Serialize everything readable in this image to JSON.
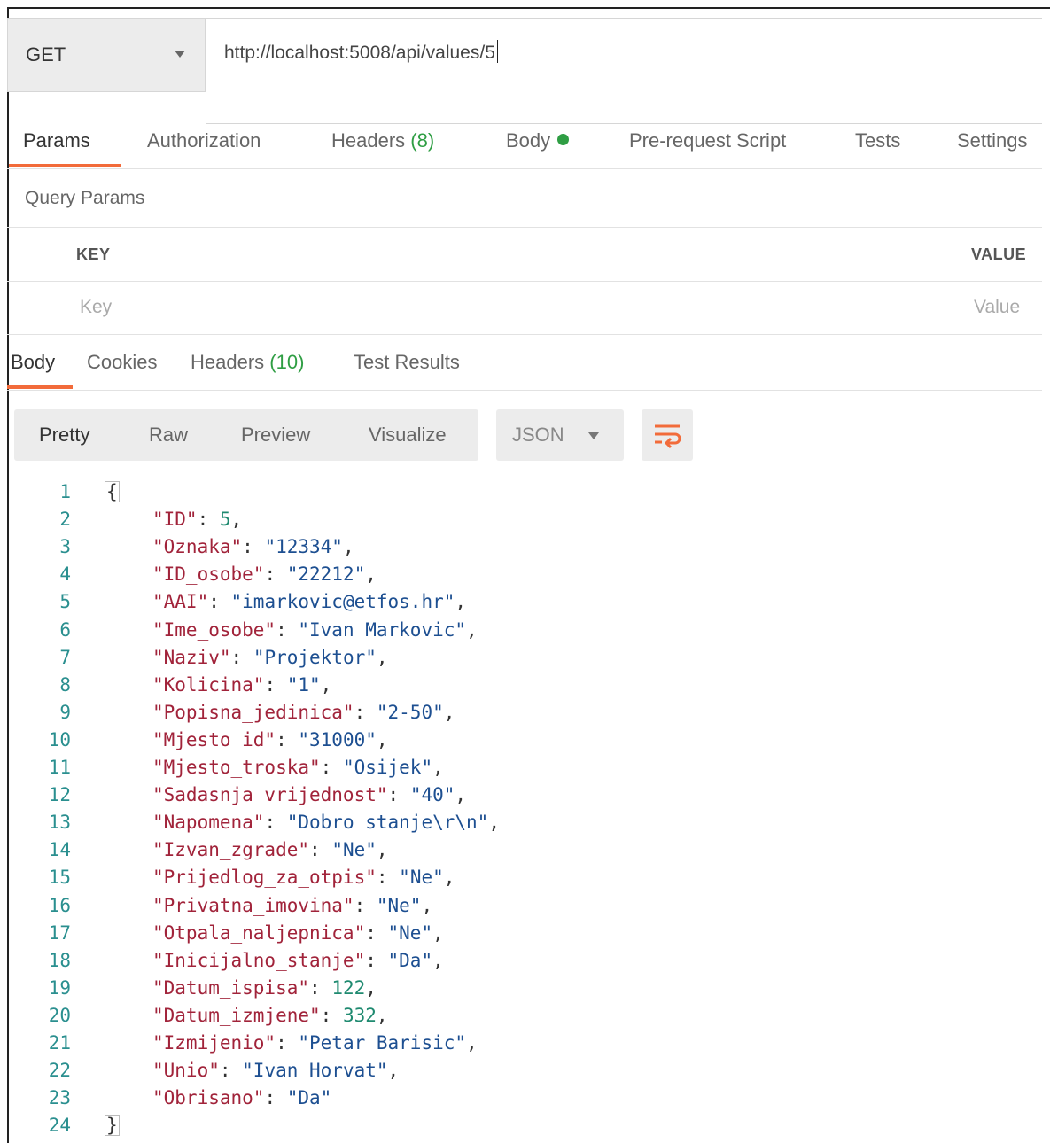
{
  "request": {
    "method": "GET",
    "url": "http://localhost:5008/api/values/5"
  },
  "request_tabs": [
    {
      "label": "Params"
    },
    {
      "label": "Authorization"
    },
    {
      "label": "Headers",
      "count": "(8)"
    },
    {
      "label": "Body"
    },
    {
      "label": "Pre-request Script"
    },
    {
      "label": "Tests"
    },
    {
      "label": "Settings"
    }
  ],
  "query_params": {
    "title": "Query Params",
    "key_header": "KEY",
    "value_header": "VALUE",
    "key_placeholder": "Key",
    "value_placeholder": "Value"
  },
  "response_tabs": [
    {
      "label": "Body"
    },
    {
      "label": "Cookies"
    },
    {
      "label": "Headers",
      "count": "(10)"
    },
    {
      "label": "Test Results"
    }
  ],
  "view_modes": [
    {
      "label": "Pretty"
    },
    {
      "label": "Raw"
    },
    {
      "label": "Preview"
    },
    {
      "label": "Visualize"
    }
  ],
  "format": "JSON",
  "colors": {
    "accent": "#f26b3a",
    "green": "#2f9e44",
    "key": "#a1233a",
    "string": "#1d4f91",
    "number": "#1f8a70",
    "line_number": "#2a8f8f"
  },
  "response_body": {
    "open": "{",
    "close": "}",
    "fields": [
      {
        "key": "\"ID\"",
        "value": "5",
        "type": "number"
      },
      {
        "key": "\"Oznaka\"",
        "value": "\"12334\"",
        "type": "string"
      },
      {
        "key": "\"ID_osobe\"",
        "value": "\"22212\"",
        "type": "string"
      },
      {
        "key": "\"AAI\"",
        "value": "\"imarkovic@etfos.hr\"",
        "type": "string"
      },
      {
        "key": "\"Ime_osobe\"",
        "value": "\"Ivan Markovic\"",
        "type": "string"
      },
      {
        "key": "\"Naziv\"",
        "value": "\"Projektor\"",
        "type": "string"
      },
      {
        "key": "\"Kolicina\"",
        "value": "\"1\"",
        "type": "string"
      },
      {
        "key": "\"Popisna_jedinica\"",
        "value": "\"2-50\"",
        "type": "string"
      },
      {
        "key": "\"Mjesto_id\"",
        "value": "\"31000\"",
        "type": "string"
      },
      {
        "key": "\"Mjesto_troska\"",
        "value": "\"Osijek\"",
        "type": "string"
      },
      {
        "key": "\"Sadasnja_vrijednost\"",
        "value": "\"40\"",
        "type": "string"
      },
      {
        "key": "\"Napomena\"",
        "value": "\"Dobro stanje\\r\\n\"",
        "type": "string"
      },
      {
        "key": "\"Izvan_zgrade\"",
        "value": "\"Ne\"",
        "type": "string"
      },
      {
        "key": "\"Prijedlog_za_otpis\"",
        "value": "\"Ne\"",
        "type": "string"
      },
      {
        "key": "\"Privatna_imovina\"",
        "value": "\"Ne\"",
        "type": "string"
      },
      {
        "key": "\"Otpala_naljepnica\"",
        "value": "\"Ne\"",
        "type": "string"
      },
      {
        "key": "\"Inicijalno_stanje\"",
        "value": "\"Da\"",
        "type": "string"
      },
      {
        "key": "\"Datum_ispisa\"",
        "value": "122",
        "type": "number"
      },
      {
        "key": "\"Datum_izmjene\"",
        "value": "332",
        "type": "number"
      },
      {
        "key": "\"Izmijenio\"",
        "value": "\"Petar Barisic\"",
        "type": "string"
      },
      {
        "key": "\"Unio\"",
        "value": "\"Ivan Horvat\"",
        "type": "string"
      },
      {
        "key": "\"Obrisano\"",
        "value": "\"Da\"",
        "type": "string"
      }
    ]
  }
}
